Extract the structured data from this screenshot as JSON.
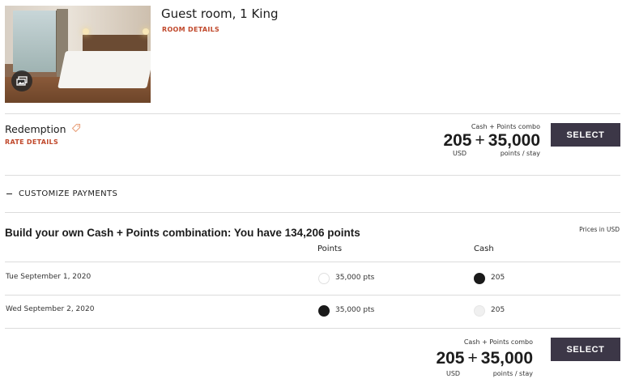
{
  "room": {
    "title": "Guest room, 1 King",
    "details_link": "ROOM DETAILS",
    "gallery_icon": "gallery-icon"
  },
  "rate": {
    "name": "Redemption",
    "tag_icon": "tag-icon",
    "details_link": "RATE DETAILS",
    "combo_label": "Cash + Points combo",
    "cash": "205",
    "plus": "+",
    "points": "35,000",
    "cash_unit": "USD",
    "points_unit": "points / stay",
    "select_label": "SELECT"
  },
  "customize": {
    "label": "CUSTOMIZE PAYMENTS"
  },
  "builder": {
    "heading": "Build your own Cash + Points combination: You have 134,206 points",
    "prices_note": "Prices in USD",
    "col_points": "Points",
    "col_cash": "Cash",
    "nights": [
      {
        "date": "Tue September 1, 2020",
        "points_label": "35,000 pts",
        "cash_label": "205",
        "selected": "cash"
      },
      {
        "date": "Wed September 2, 2020",
        "points_label": "35,000 pts",
        "cash_label": "205",
        "selected": "points"
      }
    ]
  },
  "summary": {
    "combo_label": "Cash + Points combo",
    "cash": "205",
    "plus": "+",
    "points": "35,000",
    "cash_unit": "USD",
    "points_unit": "points / stay",
    "select_label": "SELECT"
  },
  "colors": {
    "accent_link": "#c0482b",
    "button_bg": "#3c3747",
    "divider": "#dcdcdc"
  }
}
